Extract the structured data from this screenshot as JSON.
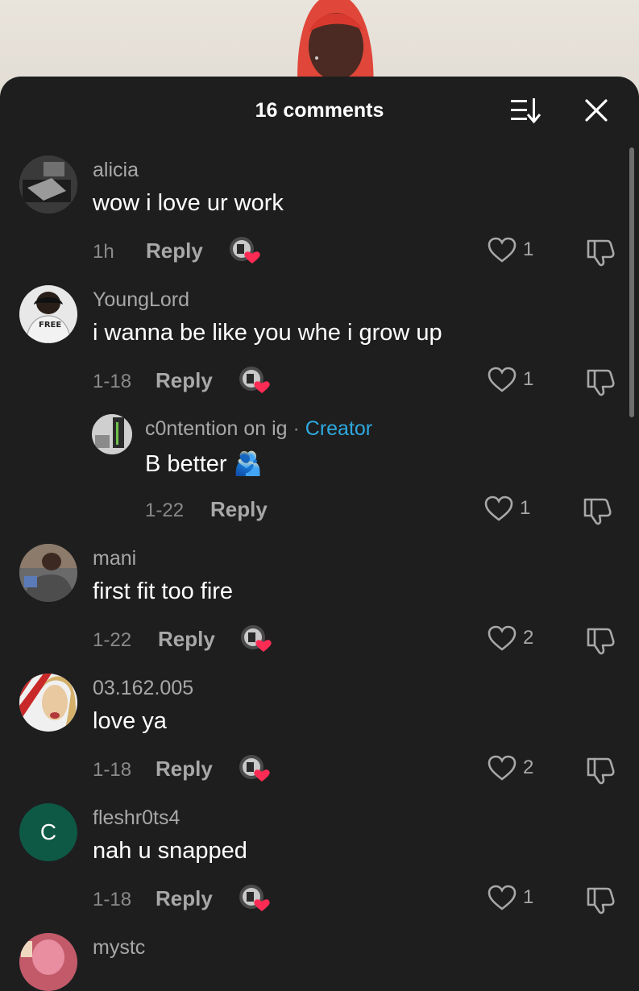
{
  "header": {
    "title": "16 comments",
    "sort_icon": "sort-icon",
    "close_icon": "close-icon"
  },
  "comments": [
    {
      "username": "alicia",
      "text": "wow i love ur work",
      "time": "1h",
      "reply": "Reply",
      "likes": "1"
    },
    {
      "username": "YoungLord",
      "text": "i wanna be like you whe i grow up",
      "time": "1-18",
      "reply": "Reply",
      "likes": "1"
    },
    {
      "username": "c0ntention on ig",
      "separator": "·",
      "badge": "Creator",
      "text": "B better",
      "emoji": "🫂",
      "time": "1-22",
      "reply": "Reply",
      "likes": "1"
    },
    {
      "username": "mani",
      "text": "first fit too fire",
      "time": "1-22",
      "reply": "Reply",
      "likes": "2"
    },
    {
      "username": "03.162.005",
      "text": "love ya",
      "time": "1-18",
      "reply": "Reply",
      "likes": "2"
    },
    {
      "username": "fleshr0ts4",
      "avatar_initial": "C",
      "text": "nah u snapped",
      "time": "1-18",
      "reply": "Reply",
      "likes": "1"
    },
    {
      "username": "mystc"
    }
  ],
  "colors": {
    "background": "#1e1e1e",
    "creator_badge": "#2ea9e0",
    "heart_red": "#fe2c55",
    "initial_avatar": "#0e5945"
  }
}
